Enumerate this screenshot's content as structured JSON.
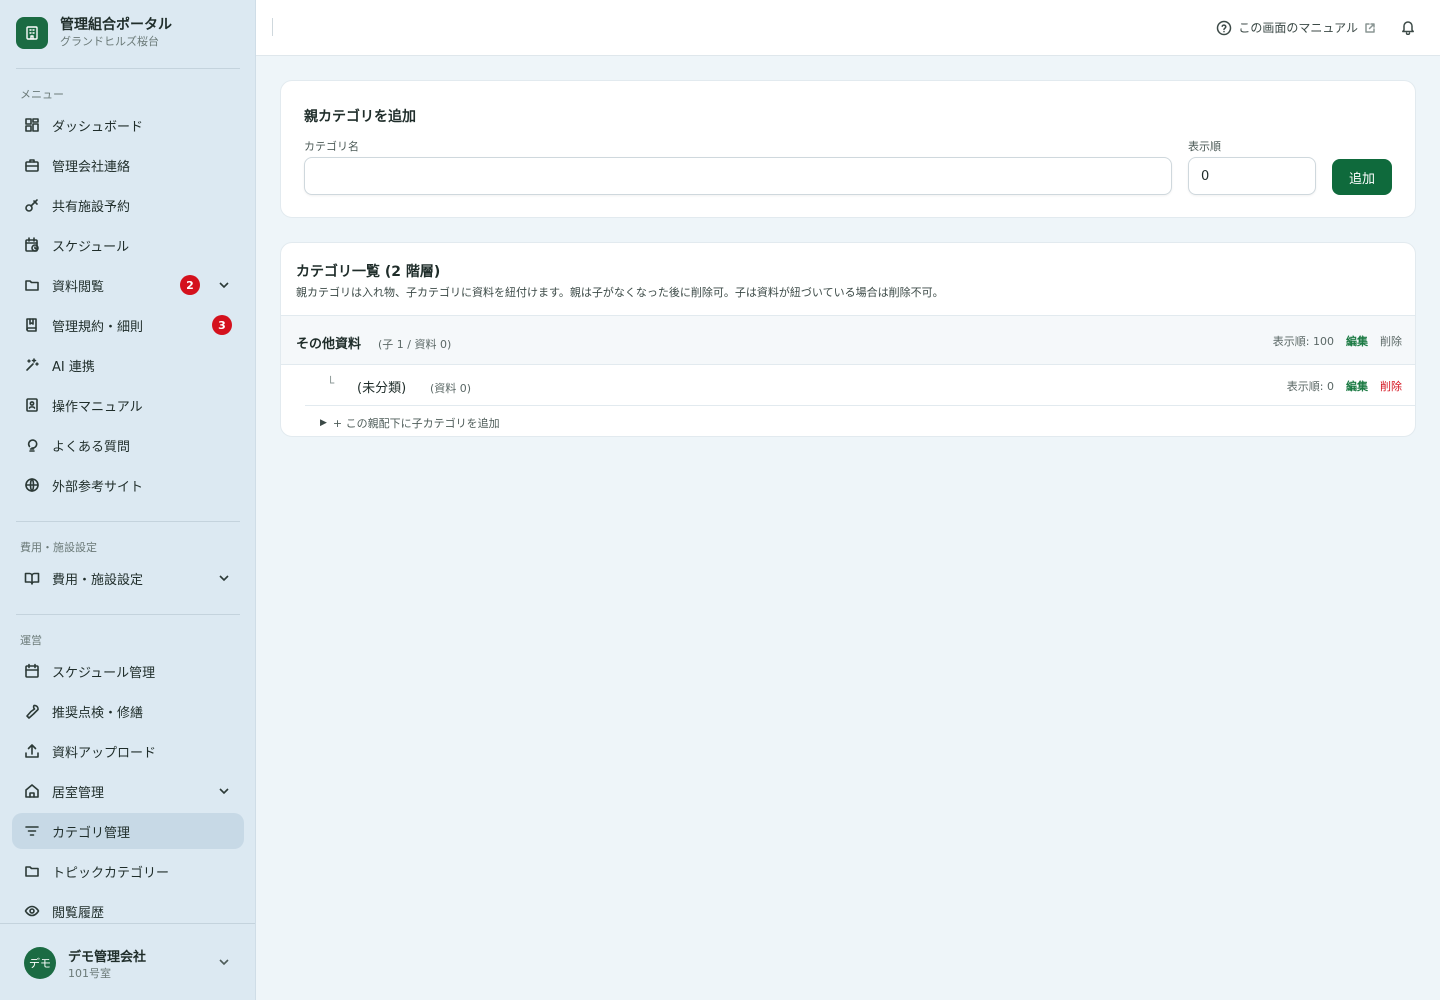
{
  "brand": {
    "title": "管理組合ポータル",
    "subtitle": "グランドヒルズ桜台"
  },
  "sidebar": {
    "menu_label": "メニュー",
    "menu_items": [
      {
        "label": "ダッシュボード",
        "icon": "dashboard-icon"
      },
      {
        "label": "管理会社連絡",
        "icon": "briefcase-icon"
      },
      {
        "label": "共有施設予約",
        "icon": "key-icon"
      },
      {
        "label": "スケジュール",
        "icon": "calendar-clock-icon"
      },
      {
        "label": "資料閲覧",
        "icon": "folder-icon",
        "badge": "2",
        "expandable": true
      },
      {
        "label": "管理規約・細則",
        "icon": "book-icon",
        "badge": "3"
      },
      {
        "label": "AI 連携",
        "icon": "sparkle-icon"
      },
      {
        "label": "操作マニュアル",
        "icon": "manual-icon"
      },
      {
        "label": "よくある質問",
        "icon": "lightbulb-icon"
      },
      {
        "label": "外部参考サイト",
        "icon": "globe-icon"
      }
    ],
    "fees_label": "費用・施設設定",
    "fees_item": {
      "label": "費用・施設設定",
      "icon": "open-book-icon"
    },
    "ops_label": "運営",
    "ops_items": [
      {
        "label": "スケジュール管理",
        "icon": "calendar-icon"
      },
      {
        "label": "推奨点検・修繕",
        "icon": "wrench-icon"
      },
      {
        "label": "資料アップロード",
        "icon": "upload-icon"
      },
      {
        "label": "居室管理",
        "icon": "home-icon"
      },
      {
        "label": "カテゴリ管理",
        "icon": "filter-icon"
      },
      {
        "label": "トピックカテゴリー",
        "icon": "folder-icon"
      },
      {
        "label": "閲覧履歴",
        "icon": "eye-icon"
      }
    ],
    "user": {
      "avatar": "デモ",
      "name": "デモ管理会社",
      "room": "101号室"
    }
  },
  "topbar": {
    "manual_label": "この画面のマニュアル"
  },
  "add_parent": {
    "title": "親カテゴリを追加",
    "name_label": "カテゴリ名",
    "name_value": "",
    "order_label": "表示順",
    "order_value": "0",
    "submit_label": "追加"
  },
  "category_list": {
    "title": "カテゴリ一覧 (2 階層)",
    "description": "親カテゴリは入れ物、子カテゴリに資料を紐付けます。親は子がなくなった後に削除可。子は資料が紐づいている場合は削除不可。",
    "parents": [
      {
        "name": "その他資料",
        "meta": "(子 1 / 資料 0)",
        "order": "表示順: 100",
        "edit_label": "編集",
        "delete_label": "削除",
        "children": [
          {
            "prefix": "└",
            "name": "(未分類)",
            "meta": "(資料 0)",
            "order": "表示順: 0",
            "edit_label": "編集",
            "delete_label": "削除"
          }
        ],
        "add_child_label": "+ この親配下に子カテゴリを追加"
      }
    ]
  },
  "colors": {
    "brand": "#1b6b43",
    "button": "#0f6a3c",
    "badge": "#d4111d",
    "delete": "#d4111d",
    "sidebar_bg": "#dce9f2",
    "page_bg": "#eef5f9"
  }
}
